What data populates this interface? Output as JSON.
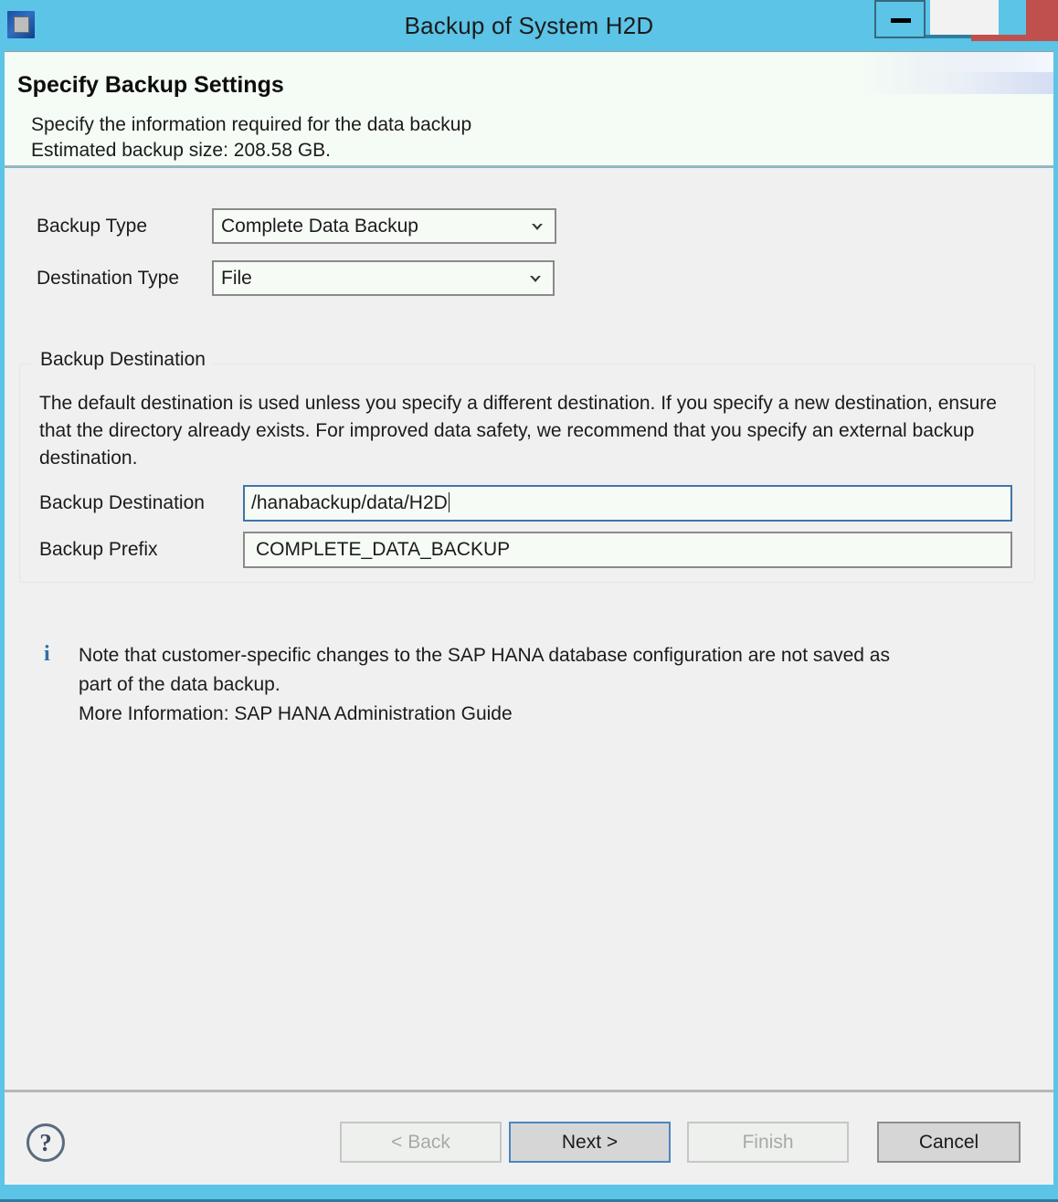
{
  "window": {
    "title": "Backup of System H2D",
    "app_icon": "hana-studio-icon",
    "controls": {
      "minimize": "minimize-icon",
      "maximize": "chevron-down-icon",
      "close": "close-icon"
    },
    "accent_color": "#5bc4e7",
    "close_color": "#c0504d"
  },
  "header": {
    "title": "Specify Backup Settings",
    "description_line1": "Specify the information required for the data backup",
    "description_line2": "Estimated backup size: 208.58 GB."
  },
  "form": {
    "backup_type": {
      "label": "Backup Type",
      "value": "Complete Data Backup",
      "arrow": "chevron-down-icon"
    },
    "destination_type": {
      "label": "Destination Type",
      "value": "File",
      "arrow": "chevron-down-icon"
    }
  },
  "backup_destination_group": {
    "title": "Backup Destination",
    "description": "The default destination is used unless you specify a different destination. If you specify a new destination, ensure that the directory already exists. For improved data safety, we recommend that you specify an external backup destination.",
    "destination": {
      "label": "Backup Destination",
      "value": "/hanabackup/data/H2D",
      "placeholder": ""
    },
    "prefix": {
      "label": "Backup Prefix",
      "value": "COMPLETE_DATA_BACKUP",
      "placeholder": ""
    }
  },
  "note": {
    "icon": "info-icon",
    "icon_glyph": "i",
    "icon_color": "#2f6fa8",
    "line1": "Note that customer-specific changes to the SAP HANA database configuration are not saved as",
    "line2": "part of the data backup.",
    "line3": "More Information: SAP HANA Administration Guide"
  },
  "buttons": {
    "help": "?",
    "back": "< Back",
    "next": "Next >",
    "finish": "Finish",
    "cancel": "Cancel"
  }
}
